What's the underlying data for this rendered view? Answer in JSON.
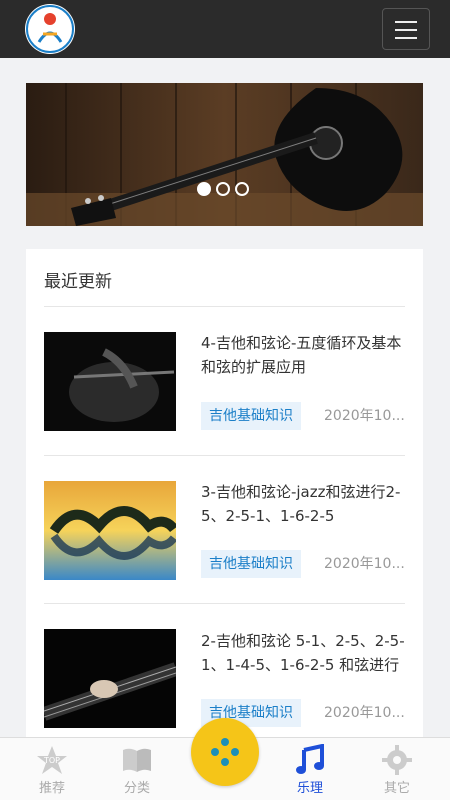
{
  "header": {
    "logo_icon": "logo-icon",
    "menu_icon": "hamburger-menu-icon"
  },
  "banner": {
    "slides": 3,
    "active_slide": 1
  },
  "latest": {
    "title": "最近更新",
    "items": [
      {
        "title": "4-吉他和弦论-五度循环及基本和弦的扩展应用",
        "tag": "吉他基础知识",
        "date": "2020年10..."
      },
      {
        "title": "3-吉他和弦论-jazz和弦进行2-5、2-5-1、1-6-2-5",
        "tag": "吉他基础知识",
        "date": "2020年10..."
      },
      {
        "title": "2-吉他和弦论 5-1、2-5、2-5-1、1-4-5、1-6-2-5 和弦进行",
        "tag": "吉他基础知识",
        "date": "2020年10..."
      }
    ]
  },
  "bottom_nav": {
    "tabs": [
      {
        "label": "推荐",
        "icon": "top-star-icon",
        "active": false
      },
      {
        "label": "分类",
        "icon": "book-icon",
        "active": false
      },
      {
        "label": "乐理",
        "icon": "music-note-icon",
        "active": true
      },
      {
        "label": "其它",
        "icon": "gear-icon",
        "active": false
      }
    ],
    "center_icon": "dots-icon"
  },
  "colors": {
    "accent": "#1e4fd8",
    "tag_text": "#1b7fc8",
    "tag_bg": "#e8f2fb",
    "center_button": "#f5c518"
  }
}
